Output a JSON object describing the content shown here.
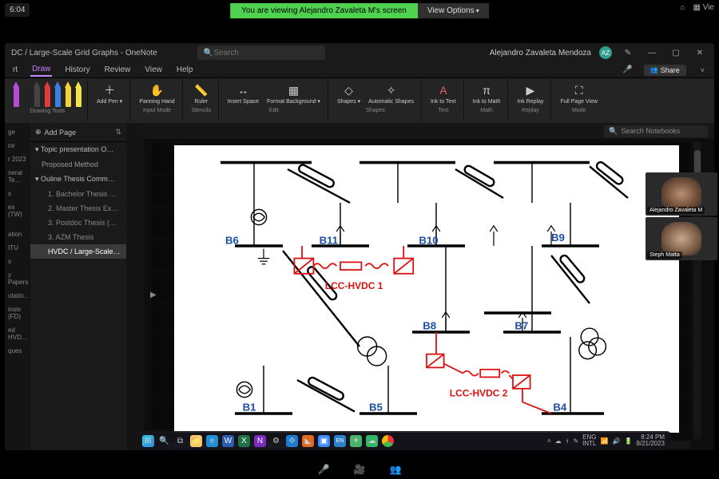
{
  "zoom": {
    "timer": "6:04",
    "share_msg": "You are viewing Alejandro Zavaleta M's screen",
    "view_options": "View Options",
    "top_right_view": "Vie"
  },
  "onenote": {
    "doc_title": "DC / Large-Scale Grid Graphs  -  OneNote",
    "search_placeholder": "Search",
    "user_name": "Alejandro Zavaleta Mendoza",
    "avatar_initials": "AZ",
    "share_label": "Share",
    "search_notebooks_placeholder": "Search Notebooks",
    "tabs": [
      {
        "label": "rt"
      },
      {
        "label": "Draw",
        "active": true
      },
      {
        "label": "History"
      },
      {
        "label": "Review"
      },
      {
        "label": "View"
      },
      {
        "label": "Help"
      }
    ],
    "ribbon": {
      "pens": [
        {
          "color": "#b84bd6"
        },
        {
          "color": "#222"
        },
        {
          "color": "#444"
        },
        {
          "color": "#e03a3a"
        },
        {
          "color": "#3a80e0"
        },
        {
          "color": "#f2d13a"
        },
        {
          "color": "#f2e34a"
        }
      ],
      "groups": {
        "drawing": "Drawing Tools",
        "input": "Input Mode",
        "stencils": "Stencils",
        "edit": "Edit",
        "shapes": "Shapes",
        "text": "Text",
        "math": "Math",
        "replay": "Replay",
        "mode": "Mode"
      },
      "buttons": {
        "add_pen": "Add Pen ▾",
        "panning": "Panning Hand",
        "ruler": "Ruler",
        "insert_space": "Insert Space",
        "format_bg": "Format Background ▾",
        "shapes": "Shapes ▾",
        "auto_shapes": "Automatic Shapes",
        "ink_text": "Ink to Text",
        "ink_math": "Ink to Math",
        "ink_replay": "Ink Replay",
        "full_page": "Full Page View"
      }
    },
    "nav": {
      "add_page": "Add Page",
      "rail_items": [
        "ge",
        "ce",
        "r 2023",
        "neral Te…",
        "s",
        "es (TW)",
        "",
        "ation",
        "ITU",
        "s",
        "y Papers",
        "utatio…",
        "iosis (FD)",
        "ed HVD…",
        "ques"
      ],
      "items": [
        {
          "label": "Topic presentation O…",
          "exp": true
        },
        {
          "label": "Proposed Method",
          "sub": true
        },
        {
          "label": "Ouline Thesis Comm…",
          "exp": true
        },
        {
          "label": "1. Bachelor Thesis …",
          "subsub": true
        },
        {
          "label": "2. Master Thesis Ex…",
          "subsub": true
        },
        {
          "label": "3. Postdoc Thesis (…",
          "subsub": true
        },
        {
          "label": "3. AZM Thesis",
          "subsub": true
        },
        {
          "label": "HVDC / Large-Scale …",
          "subsub": true,
          "active": true
        }
      ]
    }
  },
  "diagram": {
    "buses": [
      "B1",
      "B4",
      "B5",
      "B6",
      "B7",
      "B8",
      "B9",
      "B10",
      "B11"
    ],
    "hvdc": [
      "LCC-HVDC 1",
      "LCC-HVDC 2"
    ]
  },
  "taskbar": {
    "lang1": "ENG",
    "lang2": "INTL",
    "time": "8:24 PM",
    "date": "9/21/2023"
  },
  "participants": [
    {
      "name": "Alejandro Zavaleta M"
    },
    {
      "name": "Steph Matta"
    }
  ]
}
